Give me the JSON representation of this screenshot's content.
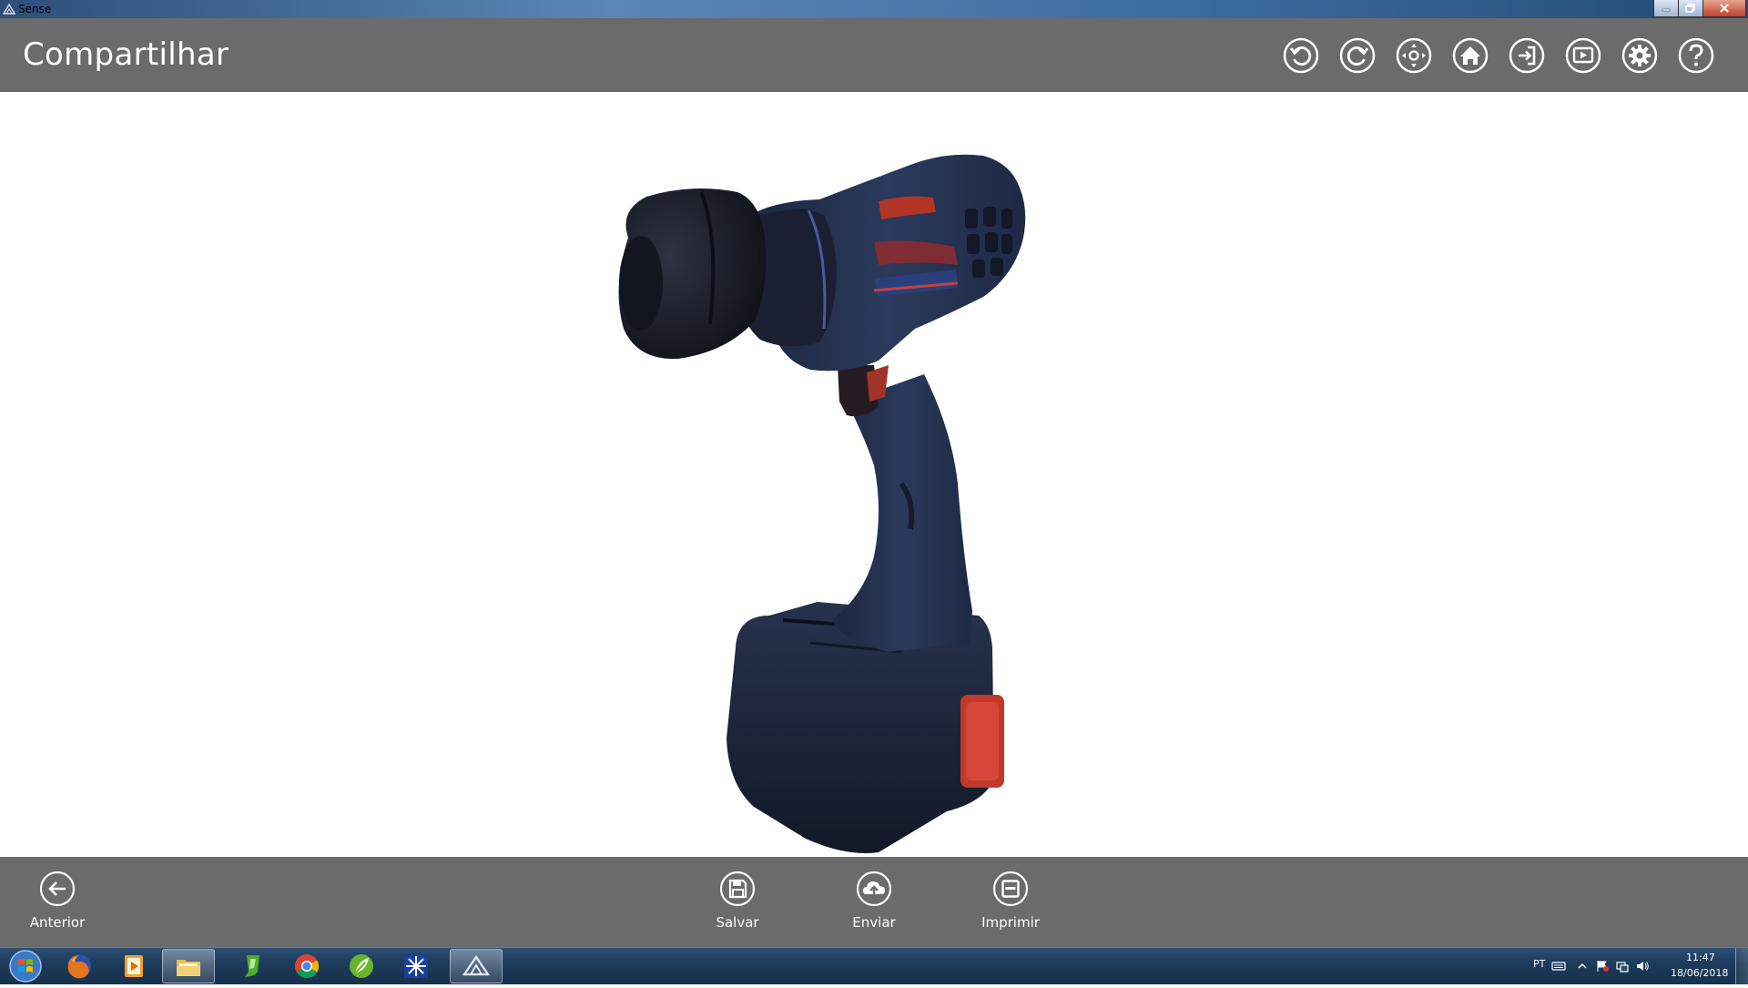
{
  "window": {
    "title": "Sense",
    "minimize_icon": "minimize-icon",
    "maximize_icon": "restore-icon",
    "close_icon": "close-icon"
  },
  "header": {
    "title": "Compartilhar",
    "actions": [
      {
        "name": "undo-icon"
      },
      {
        "name": "redo-icon"
      },
      {
        "name": "pan-move-icon"
      },
      {
        "name": "home-icon"
      },
      {
        "name": "exit-sign-in-icon"
      },
      {
        "name": "presentation-play-icon"
      },
      {
        "name": "gear-icon"
      },
      {
        "name": "help-icon"
      }
    ],
    "background": "#6b6b6b",
    "icon_color": "#ffffff"
  },
  "viewport": {
    "model": "3D scanned cordless drill",
    "background": "#ffffff"
  },
  "appbar": {
    "back": {
      "label": "Anterior",
      "icon": "back-arrow-icon"
    },
    "save": {
      "label": "Salvar",
      "icon": "save-floppy-icon"
    },
    "send": {
      "label": "Enviar",
      "icon": "cloud-upload-icon"
    },
    "print": {
      "label": "Imprimir",
      "icon": "print-icon"
    }
  },
  "taskbar": {
    "items": [
      {
        "name": "firefox-icon"
      },
      {
        "name": "media-player-icon"
      },
      {
        "name": "file-explorer-icon"
      },
      {
        "name": "green-app-icon"
      },
      {
        "name": "chrome-icon"
      },
      {
        "name": "green-leaf-app-icon"
      },
      {
        "name": "snowflake-app-icon"
      },
      {
        "name": "sense-app-icon"
      }
    ],
    "language": "PT",
    "time": "11:47",
    "date": "18/06/2018"
  }
}
